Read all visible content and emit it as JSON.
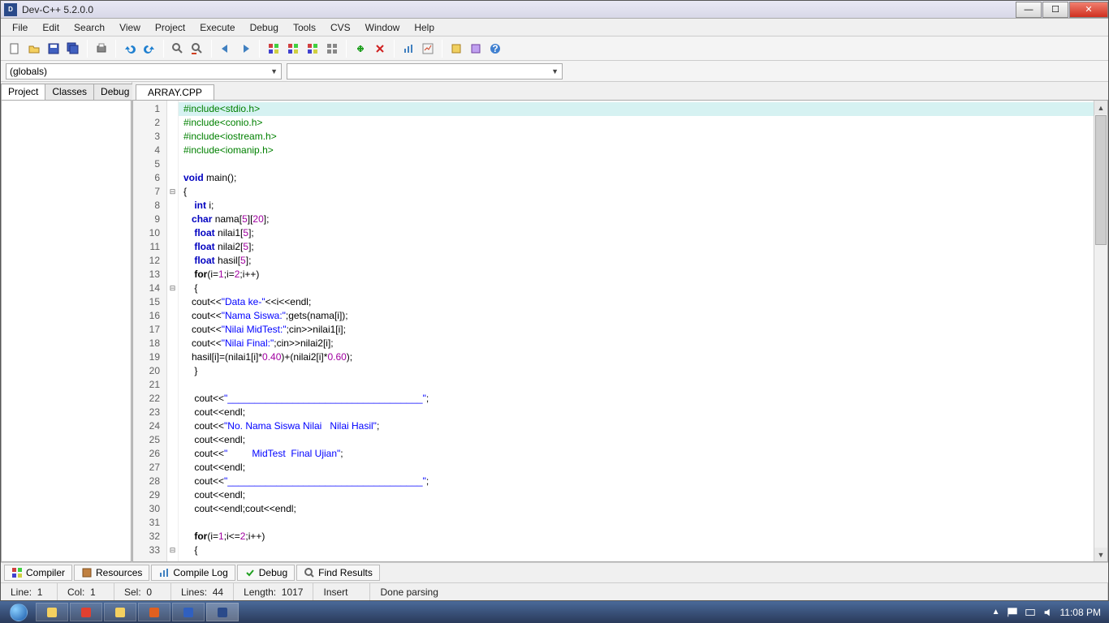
{
  "title": "Dev-C++ 5.2.0.0",
  "menu": [
    "File",
    "Edit",
    "Search",
    "View",
    "Project",
    "Execute",
    "Debug",
    "Tools",
    "CVS",
    "Window",
    "Help"
  ],
  "globals_combo": "(globals)",
  "side_tabs": [
    "Project",
    "Classes",
    "Debug"
  ],
  "file_tab": "ARRAY.CPP",
  "code_lines": [
    {
      "n": 1,
      "fold": "",
      "hl": true,
      "tokens": [
        {
          "t": "#include<stdio.h>",
          "c": "c-pre"
        }
      ]
    },
    {
      "n": 2,
      "fold": "",
      "tokens": [
        {
          "t": "#include<conio.h>",
          "c": "c-pre"
        }
      ]
    },
    {
      "n": 3,
      "fold": "",
      "tokens": [
        {
          "t": "#include<iostream.h>",
          "c": "c-pre"
        }
      ]
    },
    {
      "n": 4,
      "fold": "",
      "tokens": [
        {
          "t": "#include<iomanip.h>",
          "c": "c-pre"
        }
      ]
    },
    {
      "n": 5,
      "fold": "",
      "tokens": [
        {
          "t": ""
        }
      ]
    },
    {
      "n": 6,
      "fold": "",
      "tokens": [
        {
          "t": "void",
          "c": "c-type"
        },
        {
          "t": " main();"
        }
      ]
    },
    {
      "n": 7,
      "fold": "⊟",
      "tokens": [
        {
          "t": "{"
        }
      ]
    },
    {
      "n": 8,
      "fold": "",
      "tokens": [
        {
          "t": "    "
        },
        {
          "t": "int",
          "c": "c-type"
        },
        {
          "t": " i;"
        }
      ]
    },
    {
      "n": 9,
      "fold": "",
      "tokens": [
        {
          "t": "   "
        },
        {
          "t": "char",
          "c": "c-type"
        },
        {
          "t": " nama["
        },
        {
          "t": "5",
          "c": "c-num"
        },
        {
          "t": "]["
        },
        {
          "t": "20",
          "c": "c-num"
        },
        {
          "t": "];"
        }
      ]
    },
    {
      "n": 10,
      "fold": "",
      "tokens": [
        {
          "t": "    "
        },
        {
          "t": "float",
          "c": "c-type"
        },
        {
          "t": " nilai1["
        },
        {
          "t": "5",
          "c": "c-num"
        },
        {
          "t": "];"
        }
      ]
    },
    {
      "n": 11,
      "fold": "",
      "tokens": [
        {
          "t": "    "
        },
        {
          "t": "float",
          "c": "c-type"
        },
        {
          "t": " nilai2["
        },
        {
          "t": "5",
          "c": "c-num"
        },
        {
          "t": "];"
        }
      ]
    },
    {
      "n": 12,
      "fold": "",
      "tokens": [
        {
          "t": "    "
        },
        {
          "t": "float",
          "c": "c-type"
        },
        {
          "t": " hasil["
        },
        {
          "t": "5",
          "c": "c-num"
        },
        {
          "t": "];"
        }
      ]
    },
    {
      "n": 13,
      "fold": "",
      "tokens": [
        {
          "t": "    "
        },
        {
          "t": "for",
          "c": "c-kw"
        },
        {
          "t": "(i="
        },
        {
          "t": "1",
          "c": "c-num"
        },
        {
          "t": ";i="
        },
        {
          "t": "2",
          "c": "c-num"
        },
        {
          "t": ";i++)"
        }
      ]
    },
    {
      "n": 14,
      "fold": "⊟",
      "tokens": [
        {
          "t": "    {"
        }
      ]
    },
    {
      "n": 15,
      "fold": "",
      "tokens": [
        {
          "t": "   cout<<"
        },
        {
          "t": "\"Data ke-\"",
          "c": "c-str"
        },
        {
          "t": "<<i<<endl;"
        }
      ]
    },
    {
      "n": 16,
      "fold": "",
      "tokens": [
        {
          "t": "   cout<<"
        },
        {
          "t": "\"Nama Siswa:\"",
          "c": "c-str"
        },
        {
          "t": ";gets(nama[i]);"
        }
      ]
    },
    {
      "n": 17,
      "fold": "",
      "tokens": [
        {
          "t": "   cout<<"
        },
        {
          "t": "\"Nilai MidTest:\"",
          "c": "c-str"
        },
        {
          "t": ";cin>>nilai1[i];"
        }
      ]
    },
    {
      "n": 18,
      "fold": "",
      "tokens": [
        {
          "t": "   cout<<"
        },
        {
          "t": "\"Nilai Final:\"",
          "c": "c-str"
        },
        {
          "t": ";cin>>nilai2[i];"
        }
      ]
    },
    {
      "n": 19,
      "fold": "",
      "tokens": [
        {
          "t": "   hasil[i]=(nilai1[i]*"
        },
        {
          "t": "0.40",
          "c": "c-num"
        },
        {
          "t": ")+(nilai2[i]*"
        },
        {
          "t": "0.60",
          "c": "c-num"
        },
        {
          "t": ");"
        }
      ]
    },
    {
      "n": 20,
      "fold": "",
      "tokens": [
        {
          "t": "    }"
        }
      ]
    },
    {
      "n": 21,
      "fold": "",
      "tokens": [
        {
          "t": ""
        }
      ]
    },
    {
      "n": 22,
      "fold": "",
      "tokens": [
        {
          "t": "    cout<<"
        },
        {
          "t": "\"____________________________________\"",
          "c": "c-str"
        },
        {
          "t": ";"
        }
      ]
    },
    {
      "n": 23,
      "fold": "",
      "tokens": [
        {
          "t": "    cout<<endl;"
        }
      ]
    },
    {
      "n": 24,
      "fold": "",
      "tokens": [
        {
          "t": "    cout<<"
        },
        {
          "t": "\"No. Nama Siswa Nilai   Nilai Hasil\"",
          "c": "c-str"
        },
        {
          "t": ";"
        }
      ]
    },
    {
      "n": 25,
      "fold": "",
      "tokens": [
        {
          "t": "    cout<<endl;"
        }
      ]
    },
    {
      "n": 26,
      "fold": "",
      "tokens": [
        {
          "t": "    cout<<"
        },
        {
          "t": "\"         MidTest  Final Ujian\"",
          "c": "c-str"
        },
        {
          "t": ";"
        }
      ]
    },
    {
      "n": 27,
      "fold": "",
      "tokens": [
        {
          "t": "    cout<<endl;"
        }
      ]
    },
    {
      "n": 28,
      "fold": "",
      "tokens": [
        {
          "t": "    cout<<"
        },
        {
          "t": "\"____________________________________\"",
          "c": "c-str"
        },
        {
          "t": ";"
        }
      ]
    },
    {
      "n": 29,
      "fold": "",
      "tokens": [
        {
          "t": "    cout<<endl;"
        }
      ]
    },
    {
      "n": 30,
      "fold": "",
      "tokens": [
        {
          "t": "    cout<<endl;cout<<endl;"
        }
      ]
    },
    {
      "n": 31,
      "fold": "",
      "tokens": [
        {
          "t": ""
        }
      ]
    },
    {
      "n": 32,
      "fold": "",
      "tokens": [
        {
          "t": "    "
        },
        {
          "t": "for",
          "c": "c-kw"
        },
        {
          "t": "(i="
        },
        {
          "t": "1",
          "c": "c-num"
        },
        {
          "t": ";i<="
        },
        {
          "t": "2",
          "c": "c-num"
        },
        {
          "t": ";i++)"
        }
      ]
    },
    {
      "n": 33,
      "fold": "⊟",
      "tokens": [
        {
          "t": "    {"
        }
      ]
    }
  ],
  "bottom_tabs": [
    {
      "label": "Compiler",
      "icon": "compiler"
    },
    {
      "label": "Resources",
      "icon": "resources"
    },
    {
      "label": "Compile Log",
      "icon": "log"
    },
    {
      "label": "Debug",
      "icon": "debug"
    },
    {
      "label": "Find Results",
      "icon": "find"
    }
  ],
  "status": {
    "line_lbl": "Line:",
    "line": "1",
    "col_lbl": "Col:",
    "col": "1",
    "sel_lbl": "Sel:",
    "sel": "0",
    "lines_lbl": "Lines:",
    "lines": "44",
    "length_lbl": "Length:",
    "length": "1017",
    "mode": "Insert",
    "parse": "Done parsing"
  },
  "toolbar_icons": [
    "new",
    "open",
    "save",
    "saveall",
    "|",
    "print",
    "|",
    "undo",
    "redo",
    "|",
    "find",
    "replace",
    "|",
    "back",
    "fwd",
    "|",
    "compile",
    "run",
    "compilerun",
    "rebuild",
    "|",
    "debugstart",
    "debugstop",
    "|",
    "profile",
    "profile2",
    "|",
    "new2",
    "new3",
    "help"
  ],
  "taskbar": {
    "items": [
      "explorer",
      "chrome",
      "folder",
      "firefox",
      "word",
      "devcpp"
    ],
    "time": "11:08 PM"
  }
}
